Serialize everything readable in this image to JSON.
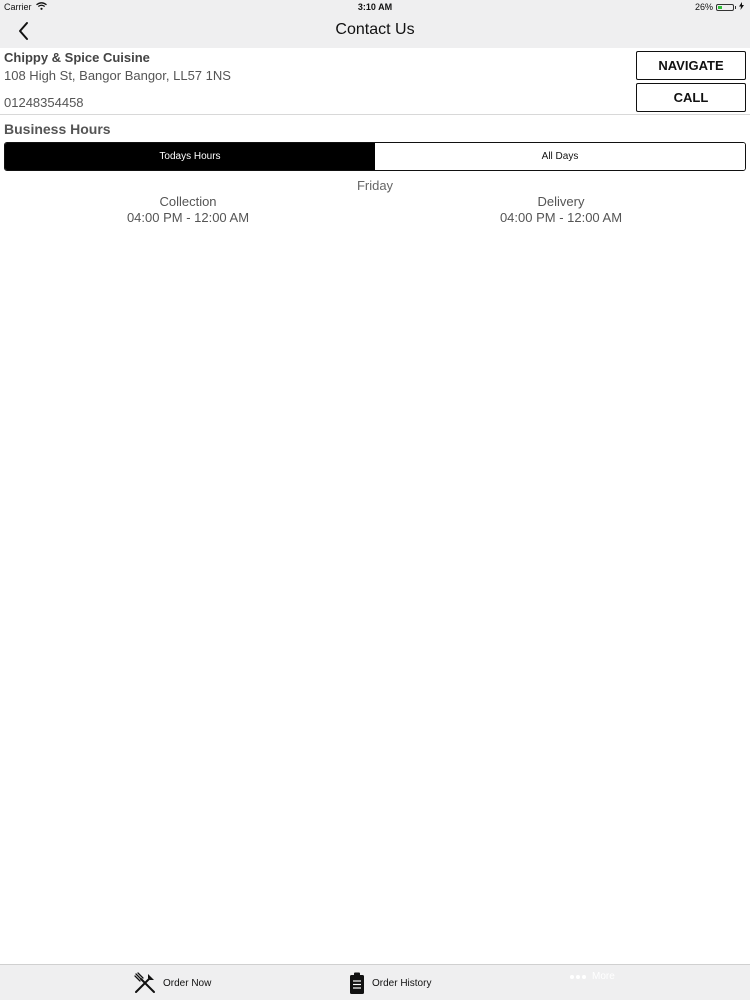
{
  "status_bar": {
    "carrier": "Carrier",
    "time": "3:10 AM",
    "battery": "26%",
    "battery_level": 0.26
  },
  "nav": {
    "title": "Contact Us"
  },
  "restaurant": {
    "name": "Chippy & Spice Cuisine",
    "address": "108 High St, Bangor Bangor, LL57 1NS",
    "phone": "01248354458"
  },
  "actions": {
    "navigate_label": "NAVIGATE",
    "call_label": "CALL"
  },
  "hours": {
    "heading": "Business Hours",
    "segments": [
      {
        "label": "Todays Hours",
        "selected": true
      },
      {
        "label": "All Days",
        "selected": false
      }
    ],
    "day": "Friday",
    "columns": [
      {
        "title": "Collection",
        "time": "04:00 PM - 12:00 AM"
      },
      {
        "title": "Delivery",
        "time": "04:00 PM - 12:00 AM"
      }
    ]
  },
  "tab_bar": {
    "tabs": [
      {
        "label": "Order Now",
        "icon": "fork-knife-icon"
      },
      {
        "label": "Order History",
        "icon": "clipboard-icon"
      },
      {
        "label": "More",
        "icon": "more-dots-icon"
      }
    ]
  }
}
